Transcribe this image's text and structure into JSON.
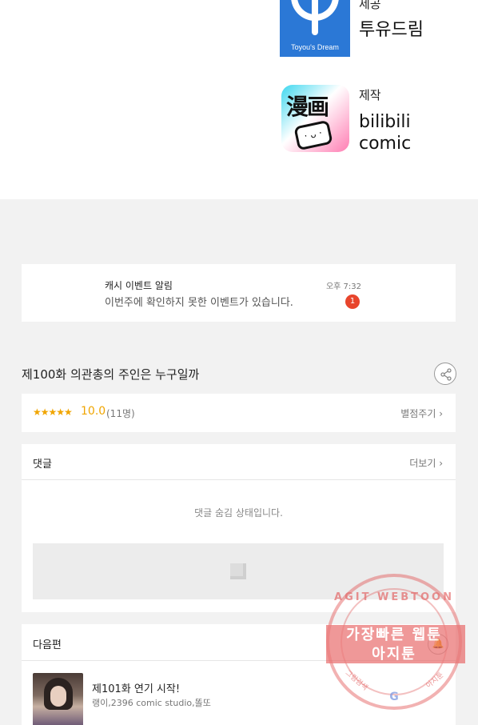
{
  "credits": {
    "publisher": {
      "role": "제공",
      "name": "투유드림",
      "logo_text": "Toyou's Dream",
      "logo_color": "#2b78d6"
    },
    "producer": {
      "role": "제작",
      "name_line1": "bilibili",
      "name_line2": "comic",
      "logo_text": "漫画"
    }
  },
  "notification": {
    "title": "캐시 이벤트 알림",
    "body": "이번주에 확인하지 못한 이벤트가 있습니다.",
    "time": "오후 7:32",
    "badge": "1",
    "badge_color": "#e8452c"
  },
  "episode": {
    "title": "제100화 의관총의 주인은 누구일까",
    "share_icon": "share-icon"
  },
  "rating": {
    "stars": "★★★★★",
    "score": "10.0",
    "count": "(11명)",
    "rate_link": "별점주기",
    "star_color": "#f0a500"
  },
  "comments": {
    "title": "댓글",
    "more": "더보기",
    "hidden_message": "댓글 숨김 상태입니다."
  },
  "next_episode": {
    "title": "다음편",
    "episode_name": "제101화 연기 시작!",
    "authors": "랭이,2396 comic studio,똘또",
    "bell_icon": "bell-icon"
  },
  "watermark": {
    "arc_text": "AGIT WEBTOON",
    "line1": "가장빠른 웹툰",
    "line2": "아지툰",
    "sub_left": "그림검색",
    "sub_right": "아지툰",
    "letter": "G",
    "color": "#e15a5a"
  }
}
